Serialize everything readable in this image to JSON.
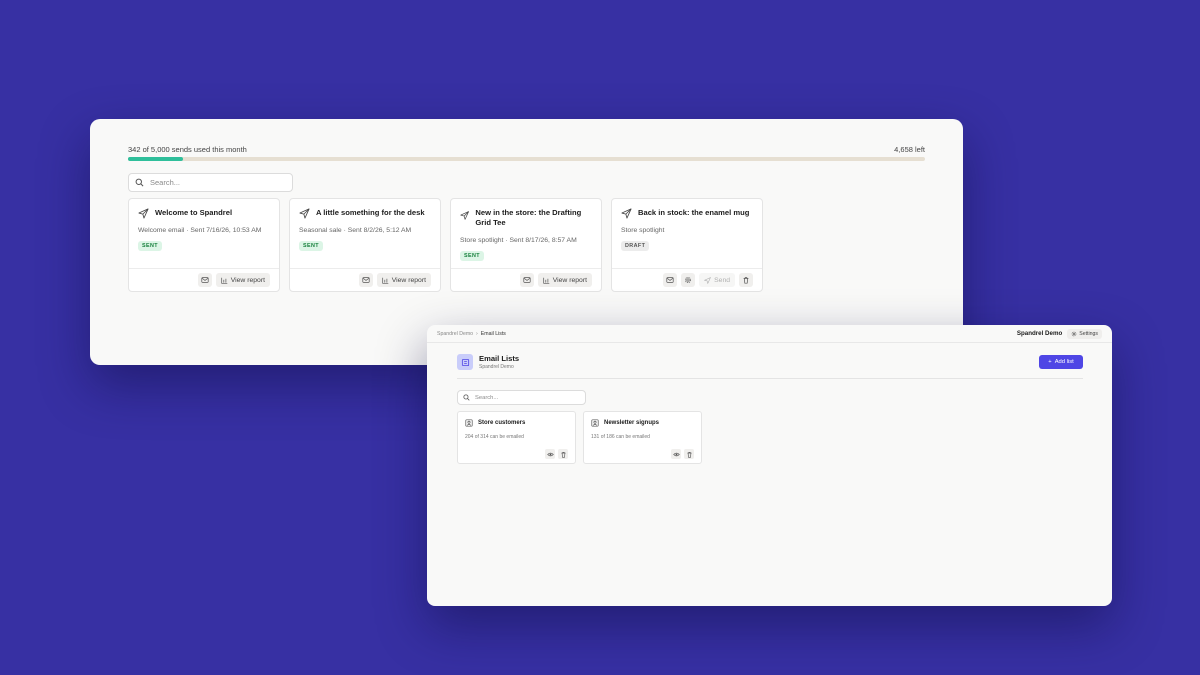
{
  "campaigns_window": {
    "usage": {
      "label": "342 of 5,000 sends used this month",
      "remaining": "4,658 left",
      "used": 342,
      "limit": 5000,
      "bar_color": "#2fbf9b"
    },
    "search": {
      "placeholder": "Search..."
    },
    "cards": [
      {
        "title": "Welcome to Spandrel",
        "meta": "Welcome email · Sent 7/16/26, 10:53 AM",
        "status": "SENT",
        "actions": [
          "email-preview",
          "View report"
        ]
      },
      {
        "title": "A little something for the desk",
        "meta": "Seasonal sale · Sent 8/2/26, 5:12 AM",
        "status": "SENT",
        "actions": [
          "email-preview",
          "View report"
        ]
      },
      {
        "title": "New in the store: the Drafting Grid Tee",
        "meta": "Store spotlight · Sent 8/17/26, 8:57 AM",
        "status": "SENT",
        "actions": [
          "email-preview",
          "View report"
        ]
      },
      {
        "title": "Back in stock: the enamel mug",
        "meta": "Store spotlight",
        "status": "DRAFT",
        "actions": [
          "email-preview",
          "settings",
          "Send",
          "delete"
        ]
      }
    ],
    "view_report_label": "View report",
    "send_label": "Send"
  },
  "lists_window": {
    "breadcrumb": [
      "Spandrel Demo",
      "Email Lists"
    ],
    "account_name": "Spandrel Demo",
    "settings_label": "Settings",
    "page_title": "Email Lists",
    "page_subtitle": "Spandrel Demo",
    "add_list_label": "Add list",
    "accent_color": "#4f46e5",
    "search": {
      "placeholder": "Search..."
    },
    "lists": [
      {
        "title": "Store customers",
        "meta": "204 of 314 can be emailed"
      },
      {
        "title": "Newsletter signups",
        "meta": "131 of 186 can be emailed"
      }
    ]
  }
}
